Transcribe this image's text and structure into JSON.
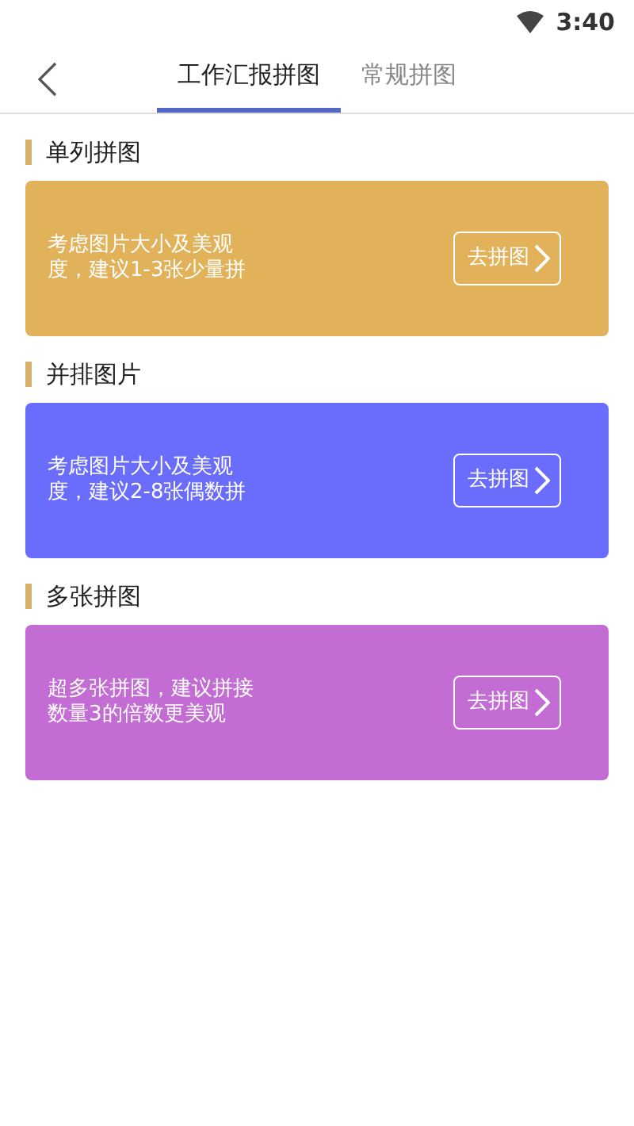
{
  "status_bar": {
    "time": "3:40"
  },
  "header": {
    "tabs": [
      {
        "label": "工作汇报拼图",
        "selected": true
      },
      {
        "label": "常规拼图",
        "selected": false
      }
    ]
  },
  "sections": [
    {
      "title": "单列拼图",
      "color": "#e2b25a",
      "description": [
        "考虑图片大小及美观",
        "度，建议1-3张少量拼"
      ],
      "button": "去拼图"
    },
    {
      "title": "并排图片",
      "color": "#6a6cfc",
      "description": [
        "考虑图片大小及美观",
        "度，建议2-8张偶数拼"
      ],
      "button": "去拼图"
    },
    {
      "title": "多张拼图",
      "color": "#c26cd4",
      "description": [
        "超多张拼图，建议拼接",
        "数量3的倍数更美观"
      ],
      "button": "去拼图"
    }
  ]
}
